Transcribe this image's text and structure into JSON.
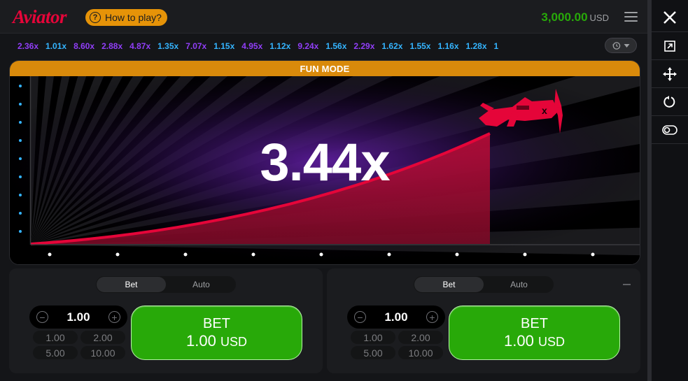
{
  "header": {
    "logo": "Aviator",
    "how_to_play": "How to play?",
    "balance_amount": "3,000.00",
    "balance_currency": "USD"
  },
  "history": [
    {
      "value": "2.36x",
      "color": "purple"
    },
    {
      "value": "1.01x",
      "color": "blue"
    },
    {
      "value": "8.60x",
      "color": "purple"
    },
    {
      "value": "2.88x",
      "color": "purple"
    },
    {
      "value": "4.87x",
      "color": "purple"
    },
    {
      "value": "1.35x",
      "color": "blue"
    },
    {
      "value": "7.07x",
      "color": "purple"
    },
    {
      "value": "1.15x",
      "color": "blue"
    },
    {
      "value": "4.95x",
      "color": "purple"
    },
    {
      "value": "1.12x",
      "color": "blue"
    },
    {
      "value": "9.24x",
      "color": "purple"
    },
    {
      "value": "1.56x",
      "color": "blue"
    },
    {
      "value": "2.29x",
      "color": "purple"
    },
    {
      "value": "1.62x",
      "color": "blue"
    },
    {
      "value": "1.55x",
      "color": "blue"
    },
    {
      "value": "1.16x",
      "color": "blue"
    },
    {
      "value": "1.28x",
      "color": "blue"
    },
    {
      "value": "1",
      "color": "blue"
    }
  ],
  "game": {
    "banner": "FUN MODE",
    "multiplier": "3.44x"
  },
  "bet_panels": [
    {
      "tab_bet": "Bet",
      "tab_auto": "Auto",
      "amount": "1.00",
      "quick": [
        "1.00",
        "2.00",
        "5.00",
        "10.00"
      ],
      "button_label": "BET",
      "button_value": "1.00",
      "button_currency": "USD"
    },
    {
      "tab_bet": "Bet",
      "tab_auto": "Auto",
      "amount": "1.00",
      "quick": [
        "1.00",
        "2.00",
        "5.00",
        "10.00"
      ],
      "button_label": "BET",
      "button_value": "1.00",
      "button_currency": "USD"
    }
  ],
  "colors": {
    "accent_red": "#e50539",
    "balance_green": "#28a909",
    "fun_mode_orange": "#d98a0b",
    "history_blue": "#34b4ff",
    "history_purple": "#913ef8"
  },
  "sidebar": {
    "icons": [
      "close-icon",
      "open-external-icon",
      "move-icon",
      "reload-icon",
      "toggle-icon"
    ]
  }
}
